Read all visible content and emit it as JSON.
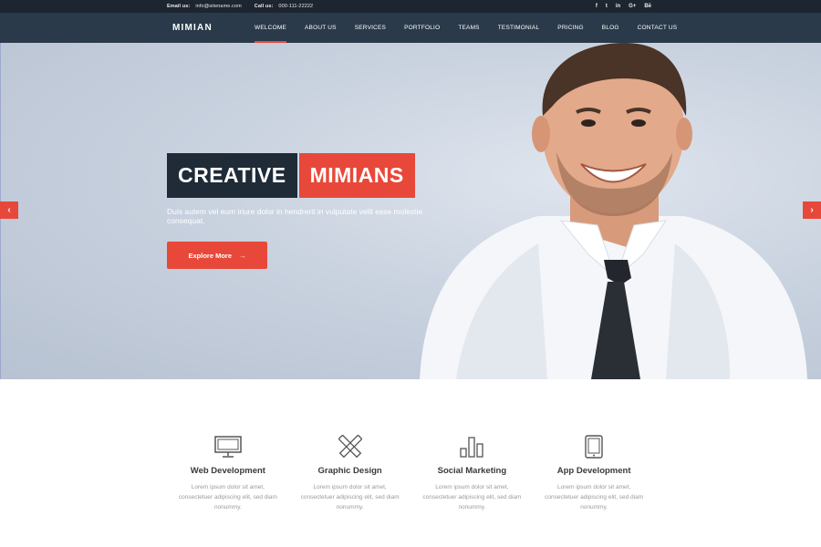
{
  "topbar": {
    "email_label": "Email us:",
    "email": "info@sitename.com",
    "call_label": "Call us:",
    "phone": "000-111-22222",
    "social": [
      "f",
      "t",
      "in",
      "G+",
      "Bē"
    ]
  },
  "navbar": {
    "brand": "MIMIAN",
    "items": [
      {
        "label": "WELCOME",
        "active": true
      },
      {
        "label": "ABOUT US"
      },
      {
        "label": "SERVICES"
      },
      {
        "label": "PORTFOLIO"
      },
      {
        "label": "TEAMS"
      },
      {
        "label": "TESTIMONIAL"
      },
      {
        "label": "PRICING"
      },
      {
        "label": "BLOG"
      },
      {
        "label": "CONTACT US"
      }
    ],
    "accent": "#e8483a"
  },
  "hero": {
    "headline_1": "CREATIVE",
    "headline_2": "MIMIANS",
    "lead": "Duis autem vel eum iriure dolor in hendrerit in vulputate velit esse molestie consequat.",
    "cta_label": "Explore More",
    "cta_icon": "→",
    "prev_icon": "‹",
    "next_icon": "›"
  },
  "services": [
    {
      "icon": "monitor-icon",
      "title": "Web Development",
      "desc": "Lorem ipsum dolor sit amet, consectetuer adipiscing elit, sed diam nonummy."
    },
    {
      "icon": "pencil-ruler-icon",
      "title": "Graphic Design",
      "desc": "Lorem ipsum dolor sit amet, consectetuer adipiscing elit, sed diam nonummy."
    },
    {
      "icon": "bar-chart-icon",
      "title": "Social Marketing",
      "desc": "Lorem ipsum dolor sit amet, consectetuer adipiscing elit, sed diam nonummy."
    },
    {
      "icon": "tablet-icon",
      "title": "App Development",
      "desc": "Lorem ipsum dolor sit amet, consectetuer adipiscing elit, sed diam nonummy."
    }
  ]
}
